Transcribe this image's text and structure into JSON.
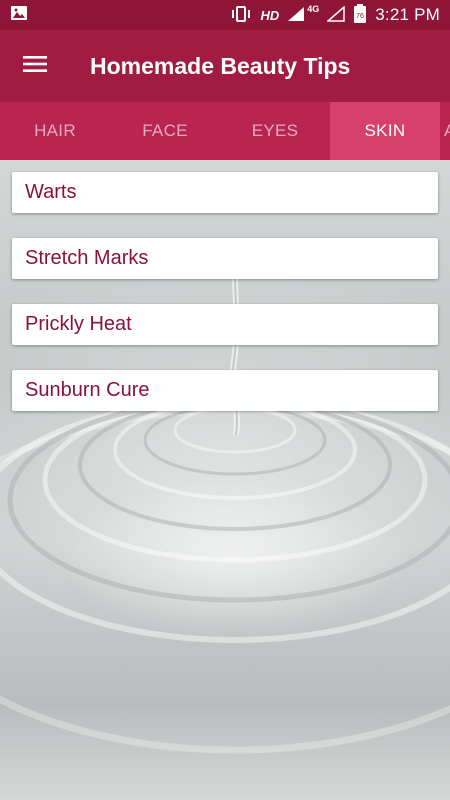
{
  "status_bar": {
    "network_hd": "HD",
    "network_type": "4G",
    "battery_level": "76",
    "time": "3:21 PM"
  },
  "app_bar": {
    "title": "Homemade Beauty Tips",
    "menu_icon": "hamburger-menu-icon"
  },
  "tabs": [
    {
      "label": "HAIR",
      "active": false
    },
    {
      "label": "FACE",
      "active": false
    },
    {
      "label": "EYES",
      "active": false
    },
    {
      "label": "SKIN",
      "active": true
    },
    {
      "label": "A",
      "active": false
    }
  ],
  "list": {
    "items": [
      {
        "label": "Warts"
      },
      {
        "label": "Stretch Marks"
      },
      {
        "label": "Prickly Heat"
      },
      {
        "label": "Sunburn Cure"
      }
    ]
  },
  "colors": {
    "status_bar": "#8e1537",
    "app_bar": "#a11b42",
    "tab_bar": "#b92451",
    "active_tab": "#d6406a",
    "item_text": "#8a1238"
  }
}
